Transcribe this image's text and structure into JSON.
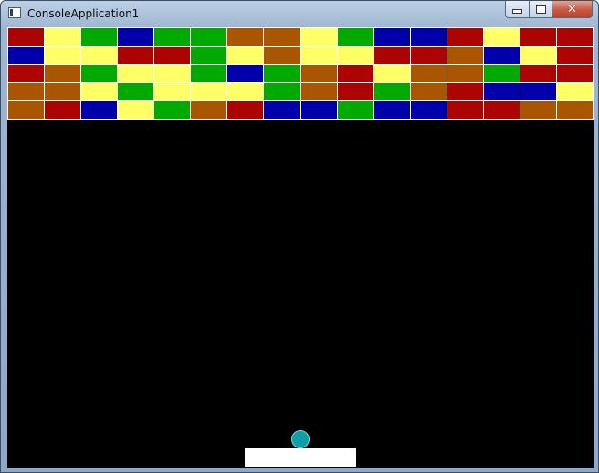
{
  "window": {
    "title": "ConsoleApplication1",
    "caption_buttons": {
      "minimize_icon": "minimize-icon",
      "maximize_icon": "maximize-icon",
      "close_icon": "close-icon",
      "close_glyph": "✕"
    }
  },
  "game": {
    "background": "#000000",
    "brick_colors": {
      "R": "#ac0303",
      "Y": "#ffff66",
      "G": "#00aa00",
      "B": "#0000aa",
      "O": "#aa5500"
    },
    "brick_rows": [
      [
        "R",
        "Y",
        "G",
        "B",
        "G",
        "G",
        "O",
        "O",
        "Y",
        "G",
        "B",
        "B",
        "R",
        "Y",
        "R",
        "R"
      ],
      [
        "B",
        "Y",
        "Y",
        "R",
        "R",
        "G",
        "Y",
        "O",
        "Y",
        "Y",
        "R",
        "R",
        "O",
        "B",
        "Y",
        "R"
      ],
      [
        "R",
        "O",
        "G",
        "Y",
        "Y",
        "G",
        "B",
        "G",
        "O",
        "R",
        "Y",
        "O",
        "O",
        "G",
        "R",
        "R"
      ],
      [
        "O",
        "O",
        "Y",
        "G",
        "Y",
        "Y",
        "Y",
        "G",
        "O",
        "R",
        "G",
        "O",
        "R",
        "B",
        "B",
        "Y"
      ],
      [
        "O",
        "R",
        "B",
        "Y",
        "G",
        "O",
        "R",
        "B",
        "B",
        "G",
        "B",
        "B",
        "R",
        "R",
        "O",
        "O"
      ]
    ],
    "ball_color": "#0f9fa8",
    "paddle_color": "#ffffff"
  }
}
